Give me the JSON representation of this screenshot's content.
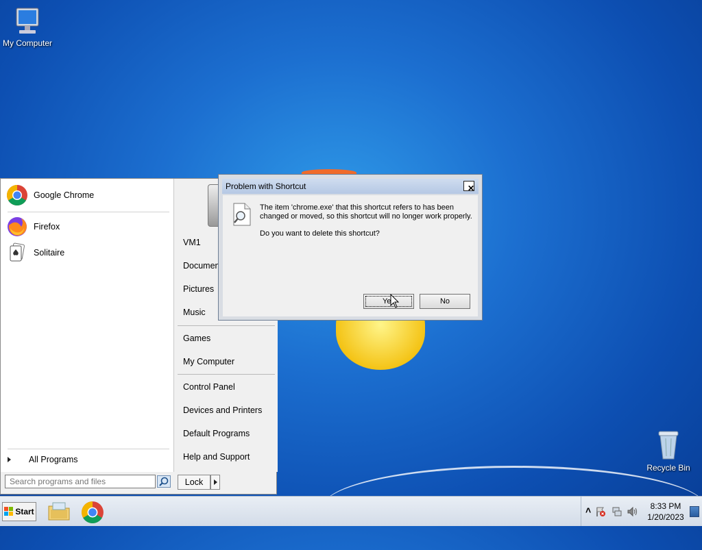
{
  "desktop": {
    "icons": [
      {
        "label": "My Computer"
      },
      {
        "label": "Recycle Bin"
      }
    ]
  },
  "start_menu": {
    "pinned": [
      {
        "label": "Google Chrome",
        "icon": "chrome-icon"
      },
      {
        "label": "Firefox",
        "icon": "firefox-icon"
      },
      {
        "label": "Solitaire",
        "icon": "solitaire-icon"
      }
    ],
    "all_programs": "All Programs",
    "search_placeholder": "Search programs and files",
    "right_items": [
      "VM1",
      "Documents",
      "Pictures",
      "Music",
      "Games",
      "My Computer",
      "Control Panel",
      "Devices and Printers",
      "Default Programs",
      "Help and Support"
    ],
    "lock_label": "Lock"
  },
  "dialog": {
    "title": "Problem with Shortcut",
    "message": "The item 'chrome.exe' that this shortcut refers to has been changed or moved, so this shortcut will no longer work properly.",
    "question": "Do you want to delete this shortcut?",
    "yes_label": "Yes",
    "no_label": "No",
    "close_glyph": "✕"
  },
  "taskbar": {
    "start_label": "Start",
    "time": "8:33 PM",
    "date": "1/20/2023",
    "tray_expand_glyph": "˄"
  },
  "colors": {
    "accent": "#1c6fd0",
    "title_bar": "#b5c8e4"
  }
}
